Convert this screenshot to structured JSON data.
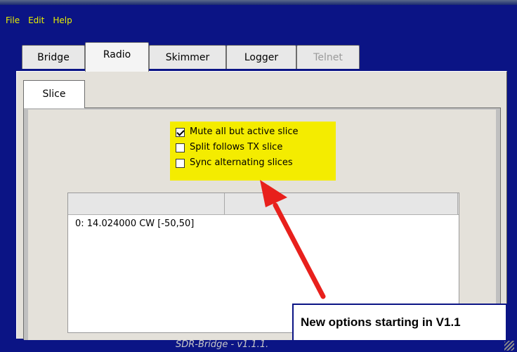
{
  "menu": {
    "items": [
      "File",
      "Edit",
      "Help"
    ]
  },
  "tabs": [
    {
      "label": "Bridge",
      "state": "normal"
    },
    {
      "label": "Radio",
      "state": "active"
    },
    {
      "label": "Skimmer",
      "state": "normal"
    },
    {
      "label": "Logger",
      "state": "normal"
    },
    {
      "label": "Telnet",
      "state": "disabled"
    }
  ],
  "subtabs": [
    {
      "label": "Slice",
      "state": "active"
    }
  ],
  "options": [
    {
      "label": "Mute all but active slice",
      "checked": true
    },
    {
      "label": "Split follows TX slice",
      "checked": false
    },
    {
      "label": "Sync alternating slices",
      "checked": false
    }
  ],
  "slice_list": {
    "rows": [
      "0: 14.024000 CW [-50,50]"
    ]
  },
  "status_bar": {
    "text": "SDR-Bridge - v1.1.1."
  },
  "callout": {
    "text": "New options starting in V1.1"
  },
  "colors": {
    "highlight": "#f4ec00",
    "arrow": "#e8201c",
    "window_frame": "#0b1485",
    "menu_text": "#e8f000"
  }
}
